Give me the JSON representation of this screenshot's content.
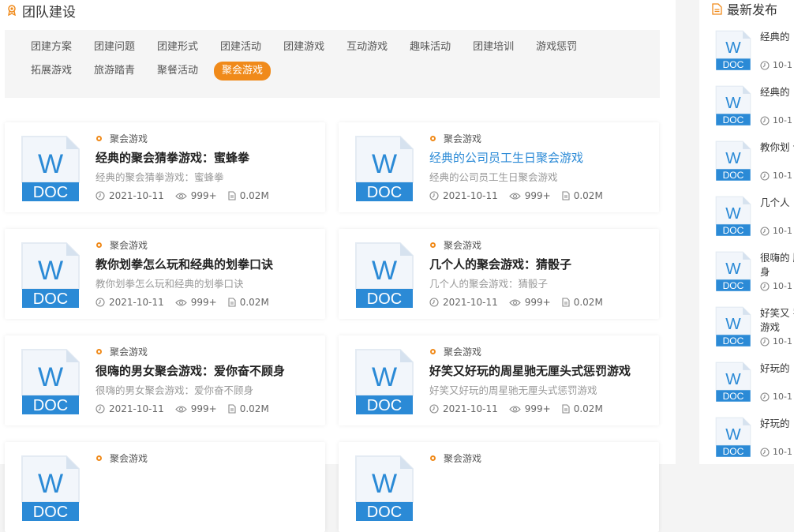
{
  "section": {
    "title": "团队建设"
  },
  "tags": [
    {
      "label": "团建方案",
      "active": false
    },
    {
      "label": "团建问题",
      "active": false
    },
    {
      "label": "团建形式",
      "active": false
    },
    {
      "label": "团建活动",
      "active": false
    },
    {
      "label": "团建游戏",
      "active": false
    },
    {
      "label": "互动游戏",
      "active": false
    },
    {
      "label": "趣味活动",
      "active": false
    },
    {
      "label": "团建培训",
      "active": false
    },
    {
      "label": "游戏惩罚",
      "active": false
    },
    {
      "label": "拓展游戏",
      "active": false
    },
    {
      "label": "旅游踏青",
      "active": false
    },
    {
      "label": "聚餐活动",
      "active": false
    },
    {
      "label": "聚会游戏",
      "active": true
    }
  ],
  "doc_icon": {
    "letter": "W",
    "type": "DOC",
    "color": "#2b8ad6"
  },
  "cards": [
    {
      "category": "聚会游戏",
      "title": "经典的聚会猜拳游戏：蜜蜂拳",
      "desc": "经典的聚会猜拳游戏：蜜蜂拳",
      "date": "2021-10-11",
      "views": "999+",
      "size": "0.02M",
      "hover": false
    },
    {
      "category": "聚会游戏",
      "title": "经典的公司员工生日聚会游戏",
      "desc": "经典的公司员工生日聚会游戏",
      "date": "2021-10-11",
      "views": "999+",
      "size": "0.02M",
      "hover": true
    },
    {
      "category": "聚会游戏",
      "title": "教你划拳怎么玩和经典的划拳口诀",
      "desc": "教你划拳怎么玩和经典的划拳口诀",
      "date": "2021-10-11",
      "views": "999+",
      "size": "0.02M",
      "hover": false
    },
    {
      "category": "聚会游戏",
      "title": "几个人的聚会游戏：猜骰子",
      "desc": "几个人的聚会游戏：猜骰子",
      "date": "2021-10-11",
      "views": "999+",
      "size": "0.02M",
      "hover": false
    },
    {
      "category": "聚会游戏",
      "title": "很嗨的男女聚会游戏：爱你奋不顾身",
      "desc": "很嗨的男女聚会游戏：爱你奋不顾身",
      "date": "2021-10-11",
      "views": "999+",
      "size": "0.02M",
      "hover": false
    },
    {
      "category": "聚会游戏",
      "title": "好笑又好玩的周星驰无厘头式惩罚游戏",
      "desc": "好笑又好玩的周星驰无厘头式惩罚游戏",
      "date": "2021-10-11",
      "views": "999+",
      "size": "0.02M",
      "hover": false
    },
    {
      "category": "聚会游戏",
      "title": "",
      "desc": "",
      "date": "",
      "views": "",
      "size": "",
      "hover": false
    },
    {
      "category": "聚会游戏",
      "title": "",
      "desc": "",
      "date": "",
      "views": "",
      "size": "",
      "hover": false
    }
  ],
  "sidebar": {
    "title": "最新发布",
    "items": [
      {
        "title": "经典的",
        "date": "10-1"
      },
      {
        "title": "经典的",
        "date": "10-1"
      },
      {
        "title": "教你划 诀",
        "date": "10-1"
      },
      {
        "title": "几个人",
        "date": "10-1"
      },
      {
        "title": "很嗨的 顾身",
        "date": "10-1"
      },
      {
        "title": "好笑又 罚游戏",
        "date": "10-1"
      },
      {
        "title": "好玩的",
        "date": "10-1"
      },
      {
        "title": "好玩的",
        "date": "10-1"
      }
    ]
  }
}
